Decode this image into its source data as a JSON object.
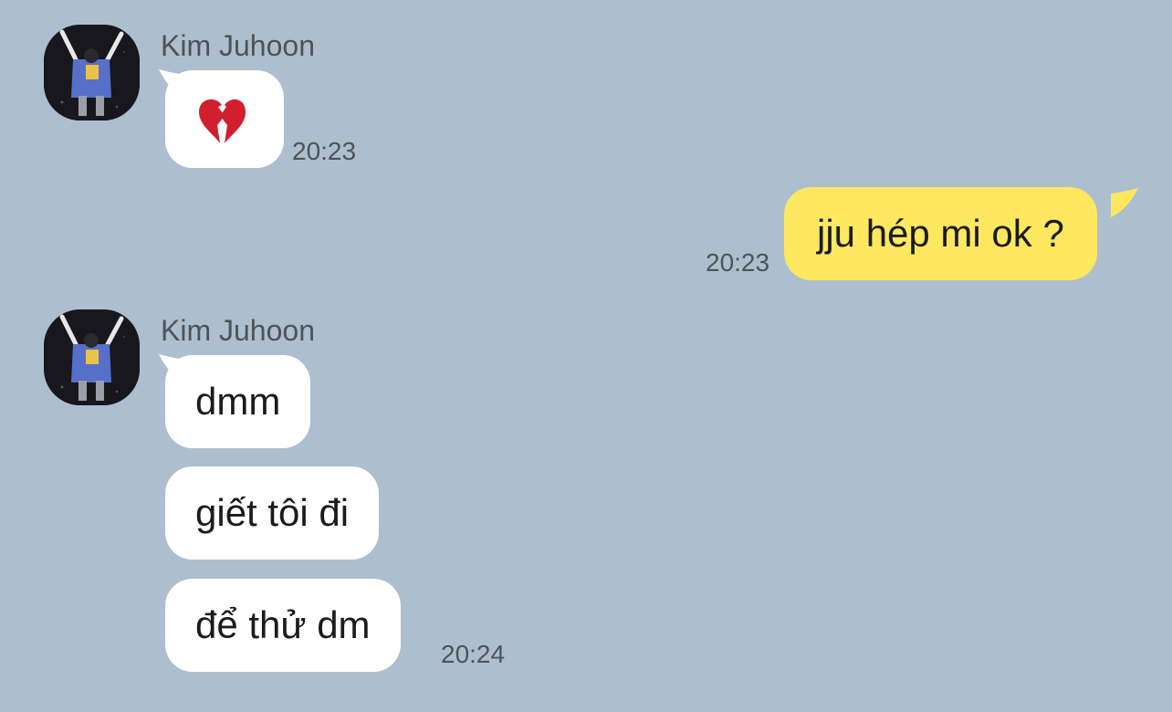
{
  "chat": {
    "messages": [
      {
        "sender": "Kim Juhoon",
        "content": "broken-heart-emoji",
        "time": "20:23"
      },
      {
        "sender": "me",
        "text": "jju hép mi ok ?",
        "time": "20:23"
      },
      {
        "sender": "Kim Juhoon",
        "text": "dmm"
      },
      {
        "sender": "Kim Juhoon",
        "text": "giết tôi đi"
      },
      {
        "sender": "Kim Juhoon",
        "text": "để thử dm",
        "time": "20:24"
      }
    ]
  },
  "colors": {
    "background": "#adbfcf",
    "incoming_bubble": "#ffffff",
    "outgoing_bubble": "#fde85f"
  },
  "icons": {
    "avatar": "profile-photo-icon",
    "emoji": "broken-heart-icon"
  }
}
